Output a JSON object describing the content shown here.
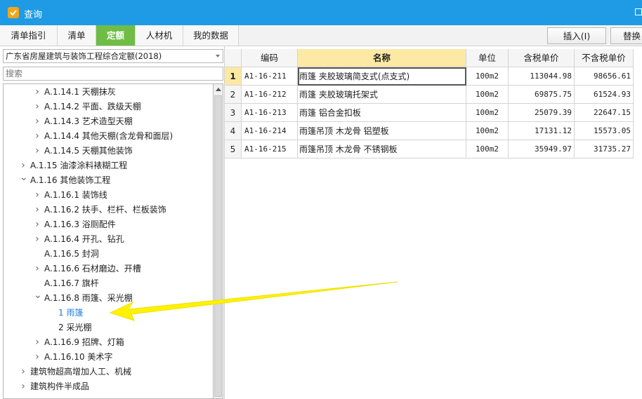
{
  "window": {
    "title": "查询",
    "accent": "#1e9be4"
  },
  "tabs": [
    {
      "label": "清单指引",
      "active": false
    },
    {
      "label": "清单",
      "active": false
    },
    {
      "label": "定额",
      "active": true
    },
    {
      "label": "人材机",
      "active": false
    },
    {
      "label": "我的数据",
      "active": false
    }
  ],
  "toolbar": {
    "insert_label": "插入(I)",
    "replace_label": "替换"
  },
  "left": {
    "quota_book": "广东省房屋建筑与装饰工程综合定额(2018)",
    "search_placeholder": "搜索",
    "tree": [
      {
        "label": "A.1.14.1 天棚抹灰",
        "level": 2,
        "state": "collapsed"
      },
      {
        "label": "A.1.14.2 平面、跌级天棚",
        "level": 2,
        "state": "collapsed"
      },
      {
        "label": "A.1.14.3 艺术造型天棚",
        "level": 2,
        "state": "collapsed"
      },
      {
        "label": "A.1.14.4 其他天棚(含龙骨和面层)",
        "level": 2,
        "state": "collapsed"
      },
      {
        "label": "A.1.14.5 天棚其他装饰",
        "level": 2,
        "state": "collapsed"
      },
      {
        "label": "A.1.15 油漆涂料裱糊工程",
        "level": 1,
        "state": "collapsed"
      },
      {
        "label": "A.1.16 其他装饰工程",
        "level": 1,
        "state": "expanded"
      },
      {
        "label": "A.1.16.1 装饰线",
        "level": 2,
        "state": "collapsed"
      },
      {
        "label": "A.1.16.2 扶手、栏杆、栏板装饰",
        "level": 2,
        "state": "collapsed"
      },
      {
        "label": "A.1.16.3 浴厕配件",
        "level": 2,
        "state": "collapsed"
      },
      {
        "label": "A.1.16.4 开孔、钻孔",
        "level": 2,
        "state": "collapsed"
      },
      {
        "label": "A.1.16.5 封洞",
        "level": 2,
        "state": "leaf"
      },
      {
        "label": "A.1.16.6 石材磨边、开槽",
        "level": 2,
        "state": "collapsed"
      },
      {
        "label": "A.1.16.7 旗杆",
        "level": 2,
        "state": "leaf"
      },
      {
        "label": "A.1.16.8 雨篷、采光棚",
        "level": 2,
        "state": "expanded"
      },
      {
        "label": "1 雨篷",
        "level": 3,
        "state": "leaf",
        "selected": true
      },
      {
        "label": "2 采光棚",
        "level": 3,
        "state": "leaf"
      },
      {
        "label": "A.1.16.9 招牌、灯箱",
        "level": 2,
        "state": "collapsed"
      },
      {
        "label": "A.1.16.10 美术字",
        "level": 2,
        "state": "collapsed"
      },
      {
        "label": "建筑物超高增加人工、机械",
        "level": 1,
        "state": "collapsed"
      },
      {
        "label": "建筑构件半成品",
        "level": 1,
        "state": "collapsed"
      }
    ]
  },
  "table": {
    "columns": [
      "",
      "编码",
      "名称",
      "单位",
      "含税单价",
      "不含税单价"
    ],
    "rows": [
      {
        "n": "1",
        "code": "A1-16-211",
        "name": "雨篷 夹胶玻璃简支式(点支式)",
        "unit": "100m2",
        "price_tax": "113044.98",
        "price_notax": "98656.61"
      },
      {
        "n": "2",
        "code": "A1-16-212",
        "name": "雨篷 夹胶玻璃托架式",
        "unit": "100m2",
        "price_tax": "69875.75",
        "price_notax": "61524.93"
      },
      {
        "n": "3",
        "code": "A1-16-213",
        "name": "雨篷 铝合金扣板",
        "unit": "100m2",
        "price_tax": "25079.39",
        "price_notax": "22647.15"
      },
      {
        "n": "4",
        "code": "A1-16-214",
        "name": "雨篷吊顶 木龙骨 铝塑板",
        "unit": "100m2",
        "price_tax": "17131.12",
        "price_notax": "15573.05"
      },
      {
        "n": "5",
        "code": "A1-16-215",
        "name": "雨篷吊顶 木龙骨 不锈钢板",
        "unit": "100m2",
        "price_tax": "35949.97",
        "price_notax": "31735.27"
      }
    ]
  },
  "annotation": {
    "arrow_color": "#fff200"
  }
}
